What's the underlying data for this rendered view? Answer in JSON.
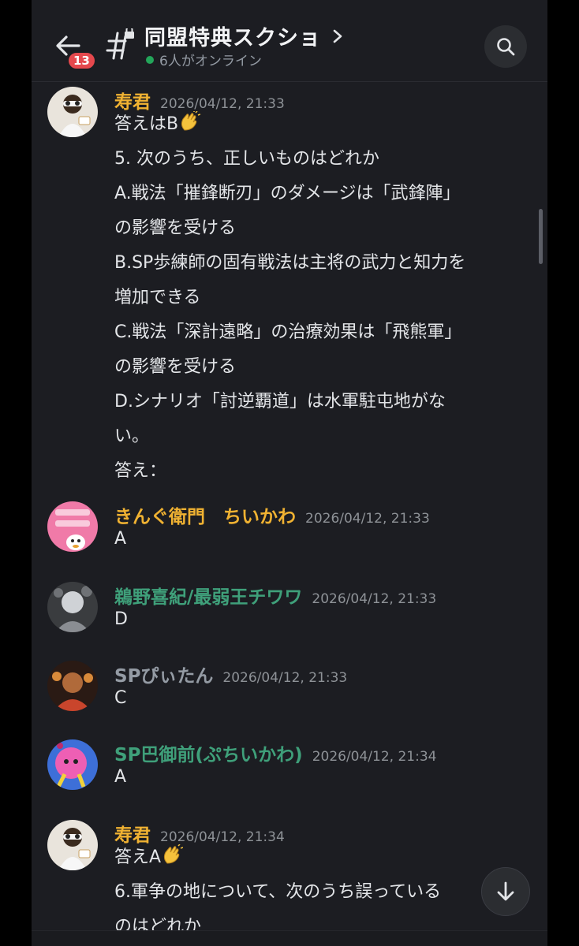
{
  "header": {
    "back_badge": "13",
    "title": "同盟特典スクショ",
    "online_status": "6人がオンライン"
  },
  "colors": {
    "background": "#1c1d22",
    "gold_name": "#f0b232",
    "green_name": "#3fa07a",
    "badge": "#e5484d",
    "online_dot": "#23a55a"
  },
  "icons": [
    "back-arrow-icon",
    "channel-hash-thread-icon",
    "chevron-right-icon",
    "search-icon",
    "clap-emoji",
    "scroll-down-arrow-icon"
  ],
  "messages": [
    {
      "author": "寿君",
      "timestamp": "2026/04/12, 21:33",
      "lines": [
        "答えはB",
        "5.  次のうち、正しいものはどれか",
        "A.戦法「摧鋒断刃」のダメージは「武鋒陣」",
        "の影響を受ける",
        "B.SP歩練師の固有戦法は主将の武力と知力を",
        "増加できる",
        "C.戦法「深計遠略」の治療効果は「飛熊軍」",
        "の影響を受ける",
        "D.シナリオ「討逆覇道」は水軍駐屯地がな",
        "い。",
        "答え："
      ]
    },
    {
      "author": "きんぐ衛門　ちいかわ",
      "timestamp": "2026/04/12, 21:33",
      "text": "A"
    },
    {
      "author": "鵜野喜紀/最弱王チワワ",
      "timestamp": "2026/04/12, 21:33",
      "text": "D"
    },
    {
      "author": "SPぴぃたん",
      "timestamp": "2026/04/12, 21:33",
      "text": "C"
    },
    {
      "author": "SP巴御前(ぷちいかわ)",
      "timestamp": "2026/04/12, 21:34",
      "text": "A"
    },
    {
      "author": "寿君",
      "timestamp": "2026/04/12, 21:34",
      "lines": [
        "答えA",
        "6.軍争の地について、次のうち誤っている",
        "のはどれか"
      ]
    }
  ]
}
